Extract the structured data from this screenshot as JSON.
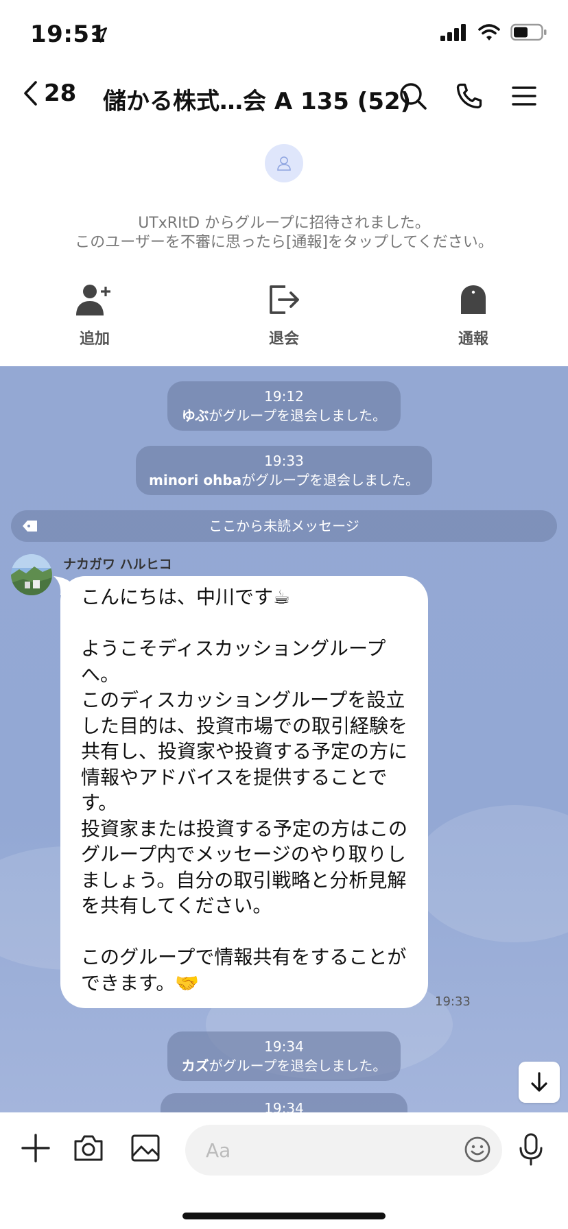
{
  "status": {
    "time": "19:51"
  },
  "header": {
    "back_count": "28",
    "title": "儲かる株式…会 A 135 (52)"
  },
  "invite": {
    "line1": "UTxRItD からグループに招待されました。",
    "line2": "このユーザーを不審に思ったら[通報]をタップしてください。",
    "actions": [
      {
        "label": "追加",
        "icon": "add-friend-icon"
      },
      {
        "label": "退会",
        "icon": "leave-icon"
      },
      {
        "label": "通報",
        "icon": "report-icon"
      }
    ]
  },
  "system_messages": [
    {
      "time": "19:12",
      "name": "ゆぶ",
      "text": "がグループを退会しました。"
    },
    {
      "time": "19:33",
      "name": "minori ohba",
      "text": "がグループを退会しました。"
    },
    {
      "time": "19:34",
      "name": "カズ",
      "text": "がグループを退会しました。"
    },
    {
      "time": "19:34"
    }
  ],
  "unread_label": "ここから未読メッセージ",
  "message": {
    "sender": "ナカガワ ハルヒコ",
    "text": "こんにちは、中川です☕\n\nようこそディスカッショングループへ。\nこのディスカッショングループを設立した目的は、投資市場での取引経験を共有し、投資家や投資する予定の方に情報やアドバイスを提供することです。\n投資家または投資する予定の方はこのグループ内でメッセージのやり取りしましょう。自分の取引戦略と分析見解を共有してください。\n\nこのグループで情報共有をすることができます。🤝",
    "time": "19:33"
  },
  "input": {
    "placeholder": "Aa"
  },
  "colors": {
    "chat_bg": "#94a8d3",
    "system_pill": "#6e7ea5"
  }
}
